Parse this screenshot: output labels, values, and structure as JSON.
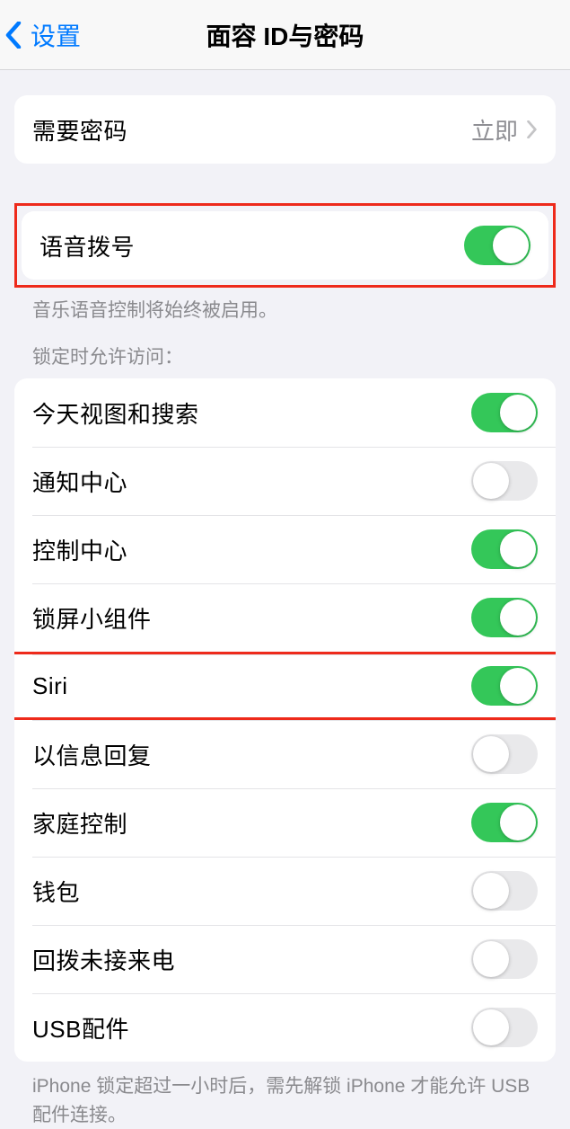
{
  "nav": {
    "back_label": "设置",
    "title": "面容 ID与密码"
  },
  "require_passcode": {
    "label": "需要密码",
    "value": "立即"
  },
  "voice_dial": {
    "label": "语音拨号",
    "enabled": true,
    "footer": "音乐语音控制将始终被启用。"
  },
  "lock_access": {
    "header": "锁定时允许访问：",
    "items": [
      {
        "label": "今天视图和搜索",
        "enabled": true
      },
      {
        "label": "通知中心",
        "enabled": false
      },
      {
        "label": "控制中心",
        "enabled": true
      },
      {
        "label": "锁屏小组件",
        "enabled": true
      },
      {
        "label": "Siri",
        "enabled": true
      },
      {
        "label": "以信息回复",
        "enabled": false
      },
      {
        "label": "家庭控制",
        "enabled": true
      },
      {
        "label": "钱包",
        "enabled": false
      },
      {
        "label": "回拨未接来电",
        "enabled": false
      },
      {
        "label": "USB配件",
        "enabled": false
      }
    ],
    "footer": "iPhone 锁定超过一小时后，需先解锁 iPhone 才能允许 USB 配件连接。"
  }
}
